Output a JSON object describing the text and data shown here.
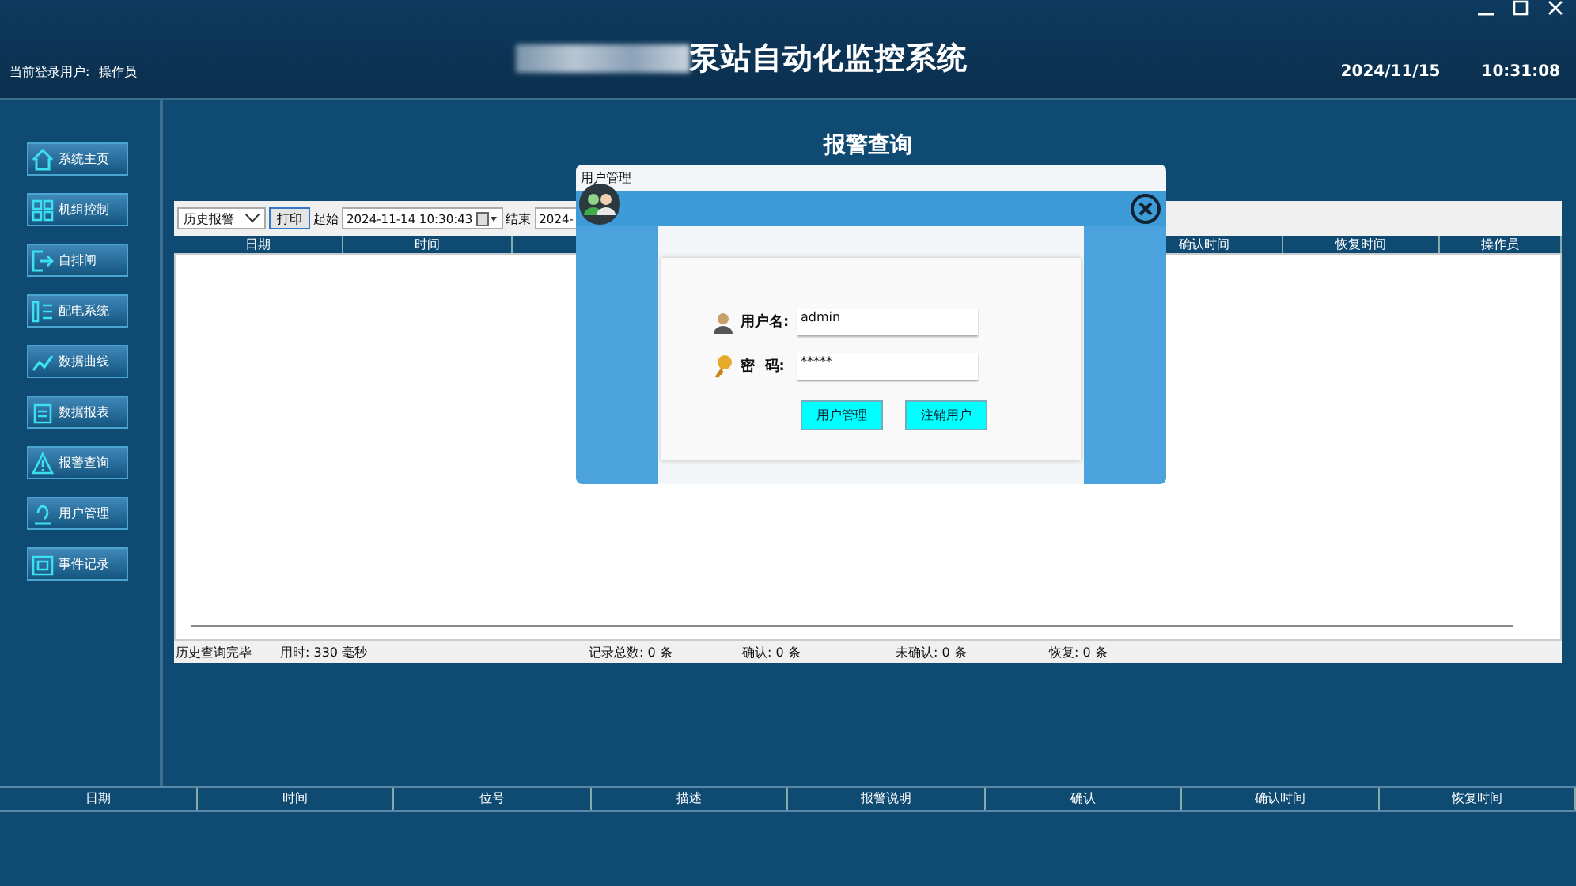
{
  "header": {
    "user_label": "当前登录用户:",
    "user_name": "操作员",
    "title": "泵站自动化监控系统",
    "date": "2024/11/15",
    "time": "10:31:08"
  },
  "sidebar": {
    "items": [
      {
        "label": "系统主页"
      },
      {
        "label": "机组控制"
      },
      {
        "label": "自排闸"
      },
      {
        "label": "配电系统"
      },
      {
        "label": "数据曲线"
      },
      {
        "label": "数据报表"
      },
      {
        "label": "报警查询"
      },
      {
        "label": "用户管理"
      },
      {
        "label": "事件记录"
      }
    ]
  },
  "page_title": "报警查询",
  "toolbar": {
    "mode": "历史报警",
    "print": "打印",
    "start_label": "起始",
    "start_value": "2024-11-14 10:30:43",
    "end_label": "结束",
    "end_value": "2024-"
  },
  "table": {
    "columns_left": [
      "日期",
      "时间"
    ],
    "columns_right": [
      "确认时间",
      "恢复时间",
      "操作员"
    ]
  },
  "status_bar": [
    "历史查询完毕",
    "用时: 330 毫秒",
    "记录总数: 0 条",
    "确认: 0 条",
    "未确认: 0 条",
    "恢复: 0 条"
  ],
  "bottom_table": {
    "columns": [
      "日期",
      "时间",
      "位号",
      "描述",
      "报警说明",
      "确认",
      "确认时间",
      "恢复时间"
    ]
  },
  "dialog": {
    "title": "用户管理",
    "username_label": "用户名:",
    "username": "admin",
    "password_label": "密  码:",
    "password": "*****",
    "buttons": [
      "用户管理",
      "注销用户"
    ]
  }
}
